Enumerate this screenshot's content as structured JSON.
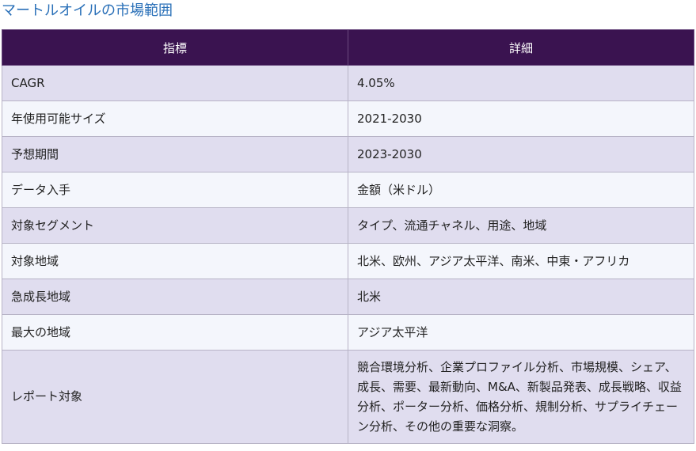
{
  "title": "マートルオイルの市場範囲",
  "table": {
    "headers": [
      "指標",
      "詳細"
    ],
    "rows": [
      {
        "metric": "CAGR",
        "detail": "4.05%"
      },
      {
        "metric": "年使用可能サイズ",
        "detail": "2021-2030"
      },
      {
        "metric": "予想期間",
        "detail": "2023-2030"
      },
      {
        "metric": "データ入手",
        "detail": "金額（米ドル）"
      },
      {
        "metric": "対象セグメント",
        "detail": "タイプ、流通チャネル、用途、地域"
      },
      {
        "metric": "対象地域",
        "detail": "北米、欧州、アジア太平洋、南米、中東・アフリカ"
      },
      {
        "metric": "急成長地域",
        "detail": "北米"
      },
      {
        "metric": "最大の地域",
        "detail": "アジア太平洋"
      },
      {
        "metric": "レポート対象",
        "detail": "競合環境分析、企業プロファイル分析、市場規模、シェア、成長、需要、最新動向、M&A、新製品発表、成長戦略、収益分析、ポーター分析、価格分析、規制分析、サプライチェーン分析、その他の重要な洞察。"
      }
    ]
  }
}
